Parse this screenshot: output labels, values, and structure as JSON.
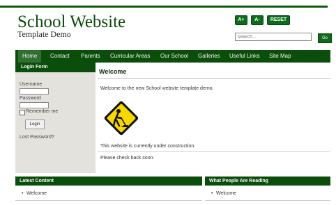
{
  "site": {
    "title": "School Website",
    "subtitle": "Template Demo"
  },
  "header_controls": {
    "font_increase": "A+",
    "font_decrease": "A-",
    "reset": "RESET",
    "search_placeholder": "search...",
    "go": "Go"
  },
  "nav": {
    "items": [
      "Home",
      "Contact",
      "Parents",
      "Curricular Areas",
      "Our School",
      "Galleries",
      "Useful Links",
      "Site Map"
    ]
  },
  "login": {
    "heading": "Login Form",
    "username_label": "Username",
    "password_label": "Password",
    "remember_label": "Remember me",
    "login_button": "Login",
    "lost_password": "Lost Password?"
  },
  "main": {
    "heading": "Welcome",
    "intro": "Welcome to the new School website template demo.",
    "line1": "This website is currently under construction.",
    "line2": "Please check back soon."
  },
  "footer": {
    "latest_heading": "Latest Content",
    "latest_items": [
      "Welcome"
    ],
    "reading_heading": "What People Are Reading",
    "reading_items": [
      "Welcome"
    ]
  },
  "colors": {
    "brand_green": "#0b4d0b",
    "nav_active": "#2f6f2f",
    "sidebar_bg": "#e4e2dc",
    "sign_yellow": "#f5d800"
  }
}
